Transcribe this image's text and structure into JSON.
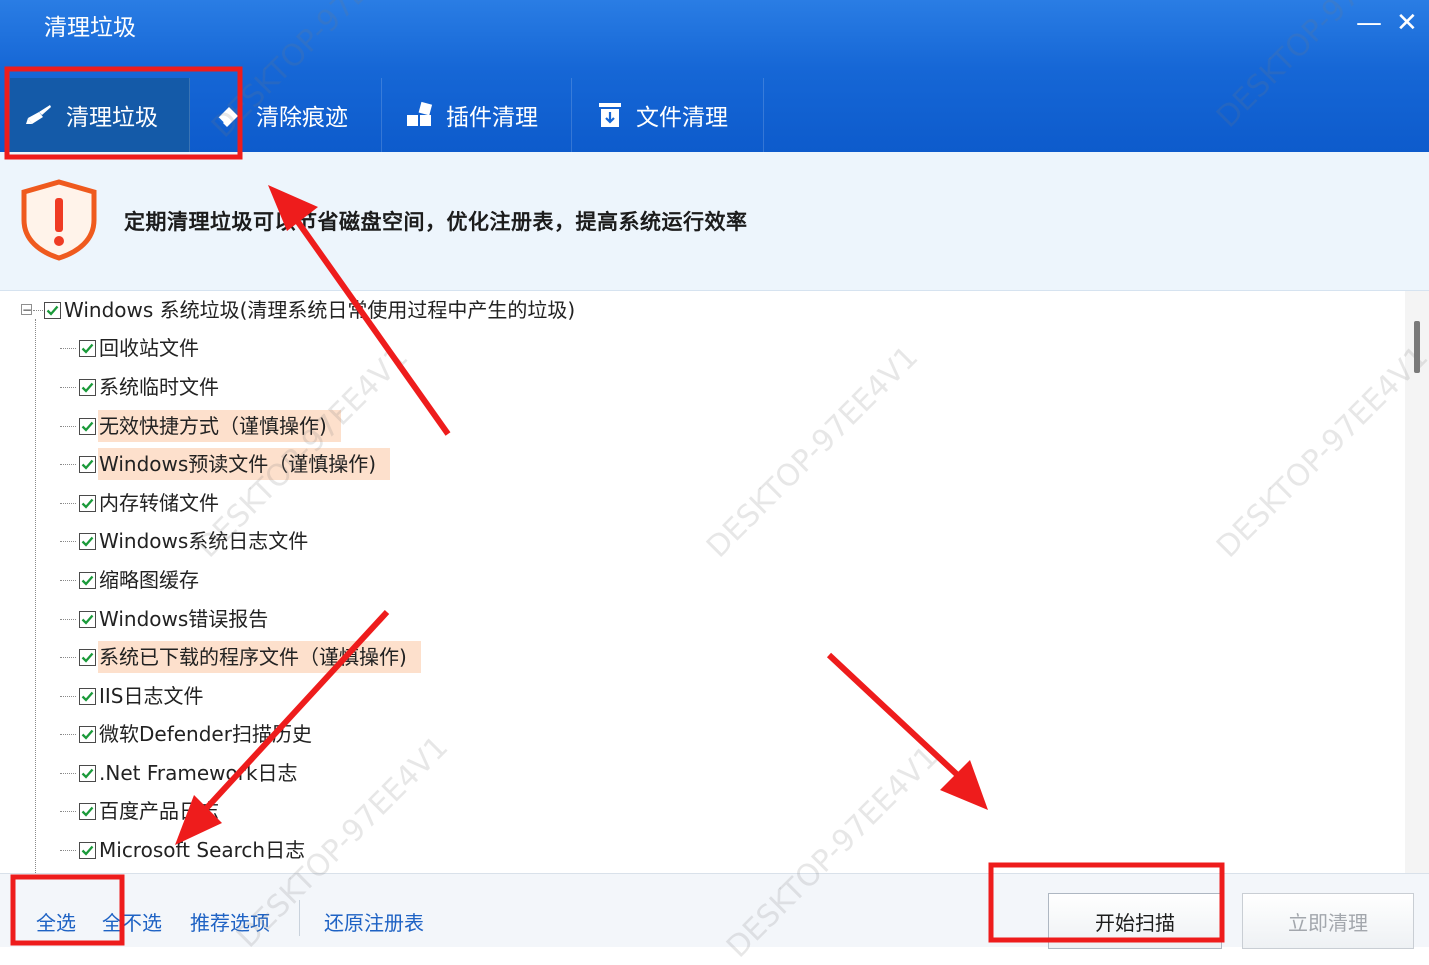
{
  "window": {
    "title": "清理垃圾",
    "minimize_glyph": "—",
    "close_glyph": "✕"
  },
  "tabs": [
    {
      "label": "清理垃圾",
      "icon": "broom-icon",
      "active": true
    },
    {
      "label": "清除痕迹",
      "icon": "eraser-icon",
      "active": false
    },
    {
      "label": "插件清理",
      "icon": "plugin-icon",
      "active": false
    },
    {
      "label": "文件清理",
      "icon": "file-trash-icon",
      "active": false
    }
  ],
  "banner": {
    "icon": "warning-shield-icon",
    "text": "定期清理垃圾可以节省磁盘空间，优化注册表，提高系统运行效率"
  },
  "tree": {
    "root": {
      "label": "Windows 系统垃圾(清理系统日常使用过程中产生的垃圾)",
      "checked": true,
      "expanded": true
    },
    "items": [
      {
        "label": "回收站文件",
        "checked": true,
        "warning": false
      },
      {
        "label": "系统临时文件",
        "checked": true,
        "warning": false
      },
      {
        "label": "无效快捷方式（谨慎操作)",
        "checked": true,
        "warning": true
      },
      {
        "label": "Windows预读文件（谨慎操作)",
        "checked": true,
        "warning": true
      },
      {
        "label": "内存转储文件",
        "checked": true,
        "warning": false
      },
      {
        "label": "Windows系统日志文件",
        "checked": true,
        "warning": false
      },
      {
        "label": "缩略图缓存",
        "checked": true,
        "warning": false
      },
      {
        "label": "Windows错误报告",
        "checked": true,
        "warning": false
      },
      {
        "label": "系统已下载的程序文件（谨慎操作)",
        "checked": true,
        "warning": true
      },
      {
        "label": "IIS日志文件",
        "checked": true,
        "warning": false
      },
      {
        "label": "微软Defender扫描历史",
        "checked": true,
        "warning": false
      },
      {
        "label": ".Net Framework日志",
        "checked": true,
        "warning": false
      },
      {
        "label": "百度产品日志",
        "checked": true,
        "warning": false
      },
      {
        "label": "Microsoft Search日志",
        "checked": true,
        "warning": false
      }
    ]
  },
  "footer": {
    "select_all": "全选",
    "select_none": "全不选",
    "recommended": "推荐选项",
    "restore_registry": "还原注册表",
    "scan_button": "开始扫描",
    "clean_button": "立即清理"
  },
  "watermark": "DESKTOP-97EE4V1",
  "colors": {
    "header_blue": "#1667d6",
    "active_tab": "#145aa8",
    "warning_highlight": "#fde0cc",
    "annotation_red": "#ee1c1c",
    "link_blue": "#1e62c4",
    "checkmark_green": "#1a9a3a"
  }
}
